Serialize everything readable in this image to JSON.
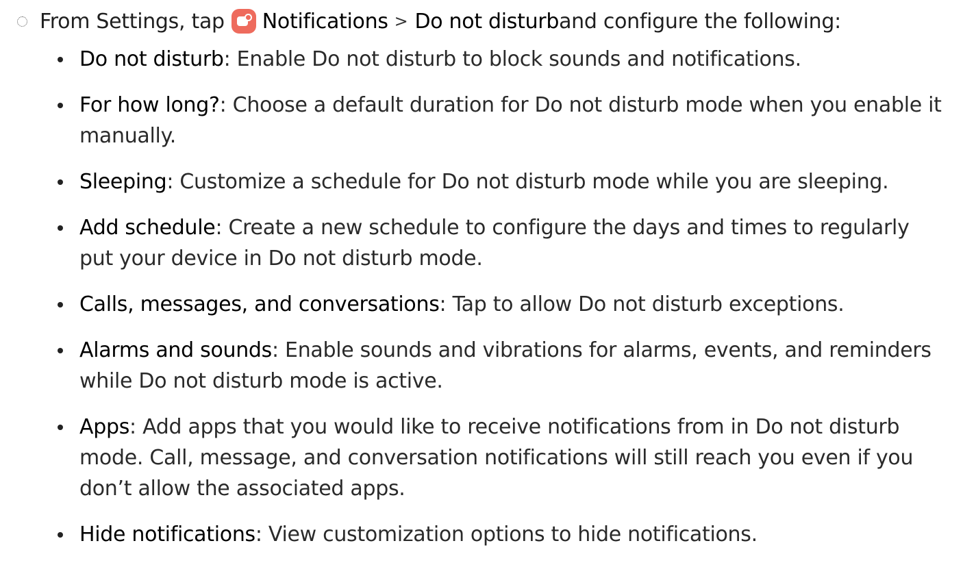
{
  "intro": {
    "prefix": "From Settings, tap ",
    "notifications_label": "Notifications",
    "chevron": ">",
    "dnd_label": "Do not disturb",
    "suffix": " and configure the following:",
    "icon": "notifications-icon",
    "icon_color": "#ee6b5d"
  },
  "items": [
    {
      "term": "Do not disturb",
      "desc": ": Enable Do not disturb to block sounds and notifications."
    },
    {
      "term": "For how long?",
      "desc": ": Choose a default duration for Do not disturb mode when you enable it manually."
    },
    {
      "term": "Sleeping",
      "desc": ": Customize a schedule for Do not disturb mode while you are sleeping."
    },
    {
      "term": "Add schedule",
      "desc": ": Create a new schedule to configure the days and times to regularly put your device in Do not disturb mode."
    },
    {
      "term": "Calls, messages, and conversations",
      "desc": ": Tap to allow Do not disturb exceptions."
    },
    {
      "term": "Alarms and sounds",
      "desc": ": Enable sounds and vibrations for alarms, events, and reminders while Do not disturb mode is active."
    },
    {
      "term": "Apps",
      "desc": ": Add apps that you would like to receive notifications from in Do not disturb mode. Call, message, and conversation notifications will still reach you even if you don’t allow the associated apps."
    },
    {
      "term": "Hide notifications",
      "desc": ": View customization options to hide notifications."
    }
  ]
}
